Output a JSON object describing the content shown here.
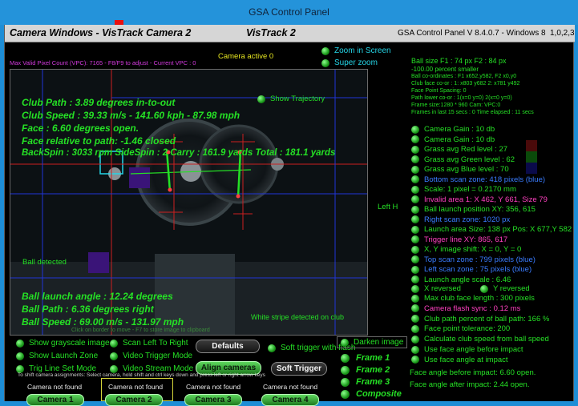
{
  "window": {
    "title": "GSA Control Panel"
  },
  "header": {
    "left": "Camera Windows - VisTrack Camera  2",
    "middle": "VisTrack 2",
    "right": "GSA Control Panel V 8.4.0.7 - Windows 8",
    "version_tag": "1,0,2,3"
  },
  "status": {
    "vpc": "Max Valid Pixel Count (VPC): 7165 - F8/F9 to adjust - Current VPC : 0",
    "camera_active": "Camera active 0"
  },
  "view_options": {
    "zoom_in_screen": "Zoom in Screen",
    "super_zoom": "Super zoom"
  },
  "overlay": {
    "show_trajectory": "Show Trajectory",
    "club_path": "Club Path : 3.89 degrees in-to-out",
    "club_speed": "Club Speed : 39.33 m/s - 141.60 kph - 87.98 mph",
    "face": "Face : 6.60 degrees open.",
    "face_rel": "Face relative to path: -1.46 closed",
    "spin": "BackSpin : 3033 rpm  SideSpin : 2  Carry : 161.9 yards  Total : 181.1 yards",
    "ball_detected": "Ball detected",
    "launch_angle": "Ball launch angle : 12.24 degrees",
    "ball_path": "Ball Path : 6.36 degrees right",
    "ball_speed": "Ball Speed : 69.00 m/s - 131.97 mph",
    "white_stripe": "White stripe detected on club",
    "click_hint": "Click on border to move - F7 to store image to clipboard"
  },
  "info": {
    "ball_size": "Ball size F1 : 74 px  F2 : 84 px",
    "percent_smaller": "-100.00 percent smaller",
    "ball_coords": "Ball co-ordinates : F1 x652,y582, F2 x0,y0",
    "club_face_coords": "Club face co-or :  1: x803 y682  2: x781 y492",
    "face_point_spacing": "Face Point Spacing: 0",
    "path_lower": "Path lower co-or : 1(x=0 y=0) 2(x=0 y=0)",
    "frame_size": "Frame size:1280 * 960 Cam:  VPC:0",
    "frames_in_last": "Frames in last 15 secs : 0 Time elapsed : 11 secs"
  },
  "settings": [
    {
      "label": "Camera Gain : 10 db",
      "color": "#25e025"
    },
    {
      "label": "Camera Gain : 10 db",
      "color": "#25e025"
    },
    {
      "label": "Grass avg Red level : 27",
      "color": "#25e025"
    },
    {
      "label": "Grass avg Green level : 62",
      "color": "#25e025"
    },
    {
      "label": "Grass avg Blue level : 70",
      "color": "#25e025"
    },
    {
      "label": "Bottom scan zone: 418 pixels (blue)",
      "color": "#3a7cff"
    },
    {
      "label": "Scale: 1 pixel = 0.2170 mm",
      "color": "#25e025"
    },
    {
      "label": "Invalid area 1: X 462, Y 661, Size 79",
      "color": "#ff40c0"
    },
    {
      "label": "Ball launch position XY: 356, 615",
      "color": "#25e025"
    },
    {
      "label": "Right scan zone: 1020 px",
      "color": "#3a7cff"
    },
    {
      "label": "Launch area Size: 138 px Pos: X 677,Y 582",
      "color": "#25e025"
    },
    {
      "label": "Trigger line XY: 865, 617",
      "color": "#ff40c0"
    },
    {
      "label": "X, Y image shift: X = 0,  Y = 0",
      "color": "#25e025"
    },
    {
      "label": "Top scan zone : 799 pixels (blue)",
      "color": "#3a7cff"
    },
    {
      "label": "Left scan zone : 75 pixels (blue)",
      "color": "#3a7cff"
    },
    {
      "label": "Launch angle scale : 6.46",
      "color": "#25e025"
    }
  ],
  "left_h": "Left H",
  "x_reversed": "X reversed",
  "y_reversed": "Y reversed",
  "settings2": [
    {
      "label": "Max club face length : 300 pixels",
      "color": "#25e025"
    },
    {
      "label": "Camera flash sync :  0.12 ms",
      "color": "#ff40c0"
    },
    {
      "label": "Club path percent of ball path: 166 %",
      "color": "#25e025"
    },
    {
      "label": "Face point tolerance: 200",
      "color": "#25e025"
    },
    {
      "label": "Calculate club speed from ball speed",
      "color": "#25e025"
    },
    {
      "label": "Use face angle before impact",
      "color": "#25e025"
    },
    {
      "label": "Use face angle at impact",
      "color": "#25e025"
    }
  ],
  "face_angle_before": "Face angle before impact: 6.60 open.",
  "face_angle_after": "Face angle after impact: 2.44 open.",
  "bottom": {
    "show_grayscale": "Show grayscale image",
    "scan_left_to_right": "Scan Left To Right",
    "defaults": "Defaults",
    "soft_trigger_flash": "Soft trigger with flash",
    "darken_image": "Darken image",
    "show_launch_zone": "Show Launch Zone",
    "video_trigger_mode": "Video Trigger Mode",
    "align_cameras": "Align cameras",
    "soft_trigger": "Soft Trigger",
    "trig_line_set_mode": "Trig Line Set Mode",
    "video_stream_mode": "Video Stream Mode",
    "assign_hint": "To shift camera assignments: Select camera, hold shift and ctrl keys down and press left or right arrow keys",
    "frame1": "Frame 1",
    "frame2": "Frame 2",
    "frame3": "Frame 3",
    "composite": "Composite",
    "camera_not_found": "Camera not found",
    "camera1": "Camera 1",
    "camera2": "Camera 2",
    "camera3": "Camera 3",
    "camera4": "Camera 4"
  },
  "colors": {
    "accent_green": "#25e025",
    "titlebar_blue": "#2493da",
    "magenta": "#d43adf",
    "cyan": "#25d6e8"
  }
}
